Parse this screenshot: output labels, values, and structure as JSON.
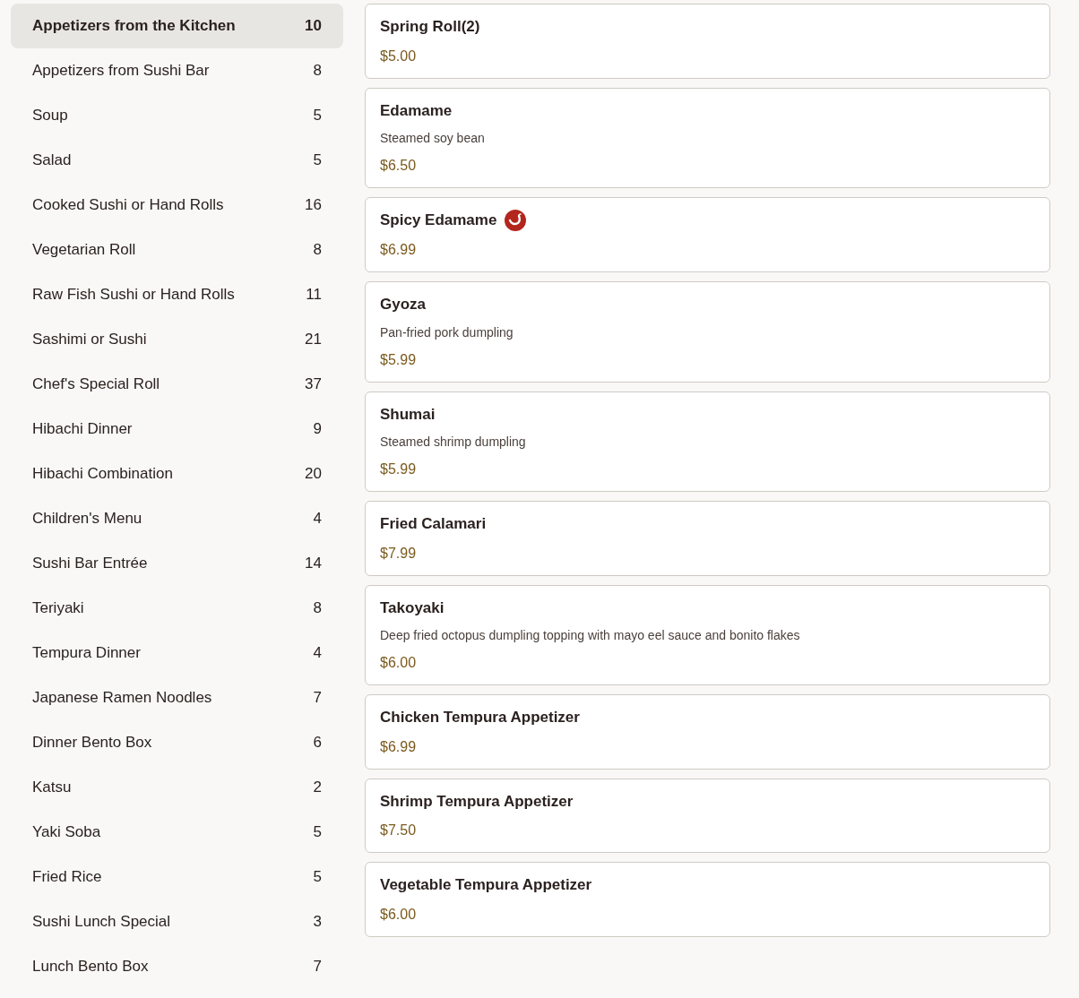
{
  "categories": [
    {
      "name": "Appetizers from the Kitchen",
      "count": "10",
      "selected": true
    },
    {
      "name": "Appetizers from Sushi Bar",
      "count": "8",
      "selected": false
    },
    {
      "name": "Soup",
      "count": "5",
      "selected": false
    },
    {
      "name": "Salad",
      "count": "5",
      "selected": false
    },
    {
      "name": "Cooked Sushi or Hand Rolls",
      "count": "16",
      "selected": false
    },
    {
      "name": "Vegetarian Roll",
      "count": "8",
      "selected": false
    },
    {
      "name": "Raw Fish Sushi or Hand Rolls",
      "count": "11",
      "selected": false
    },
    {
      "name": "Sashimi or Sushi",
      "count": "21",
      "selected": false
    },
    {
      "name": "Chef's Special Roll",
      "count": "37",
      "selected": false
    },
    {
      "name": "Hibachi Dinner",
      "count": "9",
      "selected": false
    },
    {
      "name": "Hibachi Combination",
      "count": "20",
      "selected": false
    },
    {
      "name": "Children's Menu",
      "count": "4",
      "selected": false
    },
    {
      "name": "Sushi Bar Entrée",
      "count": "14",
      "selected": false
    },
    {
      "name": "Teriyaki",
      "count": "8",
      "selected": false
    },
    {
      "name": "Tempura Dinner",
      "count": "4",
      "selected": false
    },
    {
      "name": "Japanese Ramen Noodles",
      "count": "7",
      "selected": false
    },
    {
      "name": "Dinner Bento Box",
      "count": "6",
      "selected": false
    },
    {
      "name": "Katsu",
      "count": "2",
      "selected": false
    },
    {
      "name": "Yaki Soba",
      "count": "5",
      "selected": false
    },
    {
      "name": "Fried Rice",
      "count": "5",
      "selected": false
    },
    {
      "name": "Sushi Lunch Special",
      "count": "3",
      "selected": false
    },
    {
      "name": "Lunch Bento Box",
      "count": "7",
      "selected": false
    }
  ],
  "items": [
    {
      "name": "Spring Roll(2)",
      "price": "$5.00",
      "spicy": false
    },
    {
      "name": "Edamame",
      "description": "Steamed soy bean",
      "price": "$6.50",
      "spicy": false
    },
    {
      "name": "Spicy Edamame",
      "price": "$6.99",
      "spicy": true
    },
    {
      "name": "Gyoza",
      "description": "Pan-fried pork dumpling",
      "price": "$5.99",
      "spicy": false
    },
    {
      "name": "Shumai",
      "description": "Steamed shrimp dumpling",
      "price": "$5.99",
      "spicy": false
    },
    {
      "name": "Fried Calamari",
      "price": "$7.99",
      "spicy": false
    },
    {
      "name": "Takoyaki",
      "description": "Deep fried octopus dumpling topping with mayo eel sauce and bonito flakes",
      "price": "$6.00",
      "spicy": false
    },
    {
      "name": "Chicken Tempura Appetizer",
      "price": "$6.99",
      "spicy": false
    },
    {
      "name": "Shrimp Tempura Appetizer",
      "price": "$7.50",
      "spicy": false
    },
    {
      "name": "Vegetable Tempura Appetizer",
      "price": "$6.00",
      "spicy": false
    }
  ]
}
